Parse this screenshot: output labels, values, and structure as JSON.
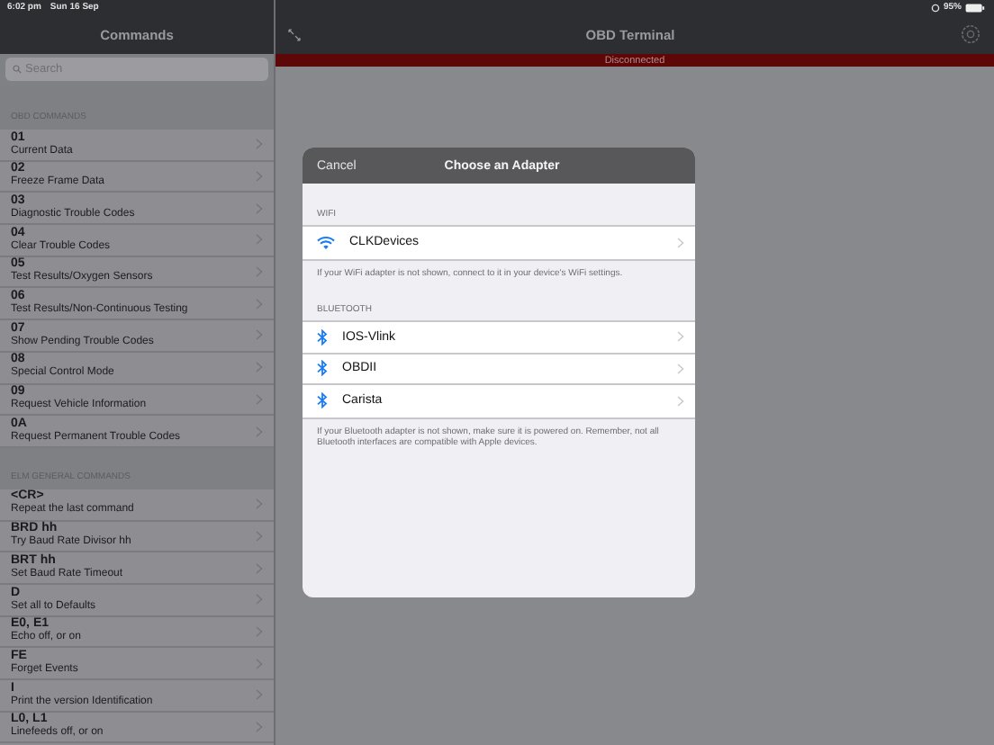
{
  "status_bar": {
    "time": "6:02 pm",
    "date": "Sun 16 Sep",
    "battery": "95%"
  },
  "sidebar": {
    "title": "Commands",
    "search": {
      "placeholder": "Search"
    },
    "sections": [
      {
        "header": "OBD COMMANDS",
        "items": [
          {
            "code": "01",
            "description": "Current Data"
          },
          {
            "code": "02",
            "description": "Freeze Frame Data"
          },
          {
            "code": "03",
            "description": "Diagnostic Trouble Codes"
          },
          {
            "code": "04",
            "description": "Clear Trouble Codes"
          },
          {
            "code": "05",
            "description": "Test Results/Oxygen Sensors"
          },
          {
            "code": "06",
            "description": "Test Results/Non-Continuous Testing"
          },
          {
            "code": "07",
            "description": "Show Pending Trouble Codes"
          },
          {
            "code": "08",
            "description": "Special Control Mode"
          },
          {
            "code": "09",
            "description": "Request Vehicle Information"
          },
          {
            "code": "0A",
            "description": "Request Permanent Trouble Codes"
          }
        ]
      },
      {
        "header": "ELM GENERAL COMMANDS",
        "items": [
          {
            "code": "<CR>",
            "description": "Repeat the last command"
          },
          {
            "code": "BRD hh",
            "description": "Try Baud Rate Divisor hh"
          },
          {
            "code": "BRT hh",
            "description": "Set Baud Rate Timeout"
          },
          {
            "code": "D",
            "description": "Set all to Defaults"
          },
          {
            "code": "E0, E1",
            "description": "Echo off, or on"
          },
          {
            "code": "FE",
            "description": "Forget Events"
          },
          {
            "code": "I",
            "description": "Print the version Identification"
          },
          {
            "code": "L0, L1",
            "description": "Linefeeds off, or on"
          }
        ]
      }
    ]
  },
  "main": {
    "title": "OBD Terminal",
    "connection_status": "Disconnected"
  },
  "dialog": {
    "cancel": "Cancel",
    "title": "Choose an Adapter",
    "sections": [
      {
        "header": "WIFI",
        "kind": "wifi",
        "devices": [
          "CLKDevices"
        ],
        "footer": "If your WiFi adapter is not shown, connect to it in your device's WiFi settings."
      },
      {
        "header": "BLUETOOTH",
        "kind": "bluetooth",
        "devices": [
          "IOS-Vlink",
          "OBDII",
          "Carista"
        ],
        "footer": "If your Bluetooth adapter is not shown, make sure it is powered on. Remember, not all Bluetooth interfaces are compatible with Apple devices."
      }
    ]
  }
}
